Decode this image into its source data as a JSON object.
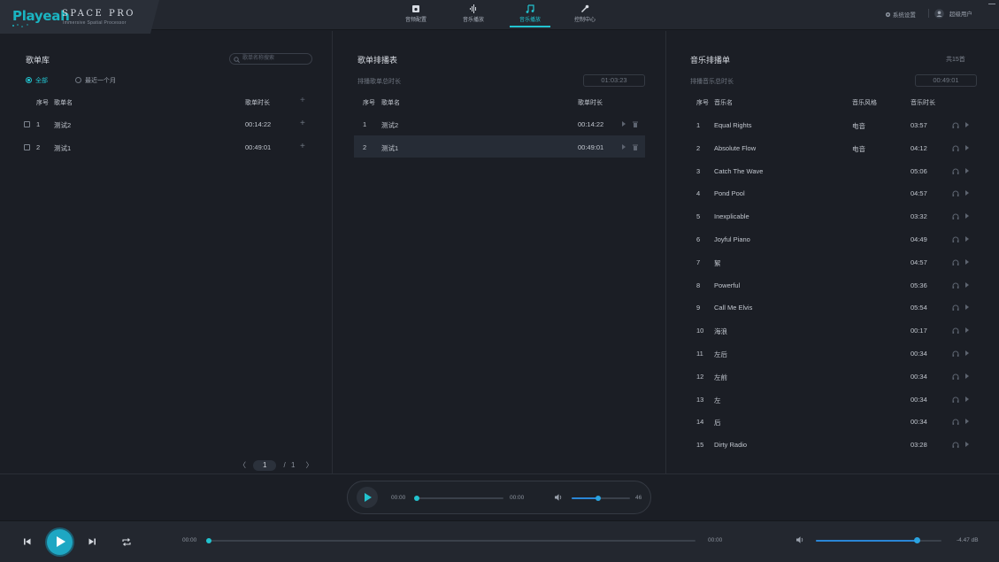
{
  "app": {
    "logo": "Playeah",
    "product": "SPACE PRO",
    "tagline": "Immersive Spatial Processor"
  },
  "nav": [
    {
      "label": "音频配置",
      "icon": "speaker-icon",
      "active": false
    },
    {
      "label": "音乐播放",
      "icon": "waveform-icon",
      "active": false
    },
    {
      "label": "音乐播放",
      "icon": "music-note-icon",
      "active": true
    },
    {
      "label": "控制中心",
      "icon": "wrench-icon",
      "active": false
    }
  ],
  "topright": {
    "settings": "系统设置",
    "user": "超级用户"
  },
  "library": {
    "title": "歌单库",
    "search_placeholder": "歌单名称搜索",
    "filter_all": "全部",
    "filter_recent": "最近一个月",
    "headers": {
      "index": "序号",
      "name": "歌单名",
      "duration": "歌单时长",
      "add": "+"
    },
    "rows": [
      {
        "index": "1",
        "name": "测试2",
        "duration": "00:14:22"
      },
      {
        "index": "2",
        "name": "测试1",
        "duration": "00:49:01"
      }
    ],
    "pager": {
      "prev": "〈",
      "current": "1",
      "sep": "/",
      "total": "1",
      "next": "〉"
    }
  },
  "schedule": {
    "title": "歌单排播表",
    "total_label": "排播歌单总时长",
    "total_value": "01:03:23",
    "headers": {
      "index": "序号",
      "name": "歌单名",
      "duration": "歌单时长"
    },
    "rows": [
      {
        "index": "1",
        "name": "测试2",
        "duration": "00:14:22",
        "selected": false
      },
      {
        "index": "2",
        "name": "测试1",
        "duration": "00:49:01",
        "selected": true
      }
    ]
  },
  "playlist": {
    "title": "音乐排播单",
    "count_label": "共15首",
    "total_label": "排播音乐总时长",
    "total_value": "00:49:01",
    "headers": {
      "index": "序号",
      "name": "音乐名",
      "style": "音乐风格",
      "duration": "音乐时长"
    },
    "rows": [
      {
        "index": "1",
        "name": "Equal Rights",
        "style": "电音",
        "duration": "03:57"
      },
      {
        "index": "2",
        "name": "Absolute Flow",
        "style": "电音",
        "duration": "04:12"
      },
      {
        "index": "3",
        "name": "Catch The Wave",
        "style": "",
        "duration": "05:06"
      },
      {
        "index": "4",
        "name": "Pond Pool",
        "style": "",
        "duration": "04:57"
      },
      {
        "index": "5",
        "name": "Inexplicable",
        "style": "",
        "duration": "03:32"
      },
      {
        "index": "6",
        "name": "Joyful Piano",
        "style": "",
        "duration": "04:49"
      },
      {
        "index": "7",
        "name": "絮",
        "style": "",
        "duration": "04:57"
      },
      {
        "index": "8",
        "name": "Powerful",
        "style": "",
        "duration": "05:36"
      },
      {
        "index": "9",
        "name": "Call Me Elvis",
        "style": "",
        "duration": "05:54"
      },
      {
        "index": "10",
        "name": "海浪",
        "style": "",
        "duration": "00:17"
      },
      {
        "index": "11",
        "name": "左后",
        "style": "",
        "duration": "00:34"
      },
      {
        "index": "12",
        "name": "左前",
        "style": "",
        "duration": "00:34"
      },
      {
        "index": "13",
        "name": "左",
        "style": "",
        "duration": "00:34"
      },
      {
        "index": "14",
        "name": "后",
        "style": "",
        "duration": "00:34"
      },
      {
        "index": "15",
        "name": "Dirty Radio",
        "style": "",
        "duration": "03:28"
      }
    ]
  },
  "mini_player": {
    "time_current": "00:00",
    "time_total": "00:00",
    "progress": 0,
    "volume": 46,
    "volume_label": "46"
  },
  "main_player": {
    "time_current": "00:00",
    "time_total": "00:00",
    "progress": 0,
    "gain_fraction": 0.8,
    "gain_label": "-4.47 dB"
  },
  "colors": {
    "accent": "#22c3cf",
    "volume_fill": "#2a86d6",
    "background": "#1b1e25"
  }
}
